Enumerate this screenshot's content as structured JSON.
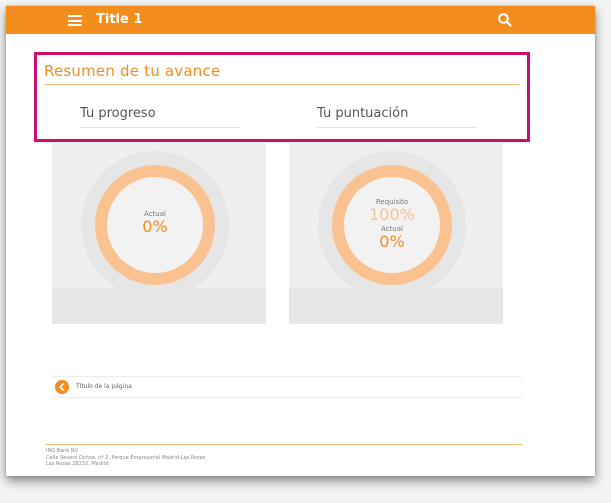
{
  "header": {
    "title": "Title 1",
    "menu_icon": "hamburger-menu-icon",
    "search_icon": "search-icon",
    "bar_color": "#f38d1d"
  },
  "section": {
    "title": "Resumen de tu avance"
  },
  "cards": [
    {
      "title": "Tu progreso",
      "current_label": "Actual",
      "current_value": "0%"
    },
    {
      "title": "Tu puntuación",
      "required_label": "Requisito",
      "required_value": "100%",
      "current_label": "Actual",
      "current_value": "0%"
    }
  ],
  "page_link": {
    "icon": "chevron-left-circle-icon",
    "label": "Título de la página"
  },
  "footer": {
    "line1": "ING Bank NV",
    "line2": "Calle Severo Ochoa, nº 2, Parque Empresarial Madrid-Las Rozas",
    "line3": "Las Rozas 28232, Madrid"
  },
  "colors": {
    "accent": "#f38d1d",
    "highlight": "#cc0f6e"
  }
}
